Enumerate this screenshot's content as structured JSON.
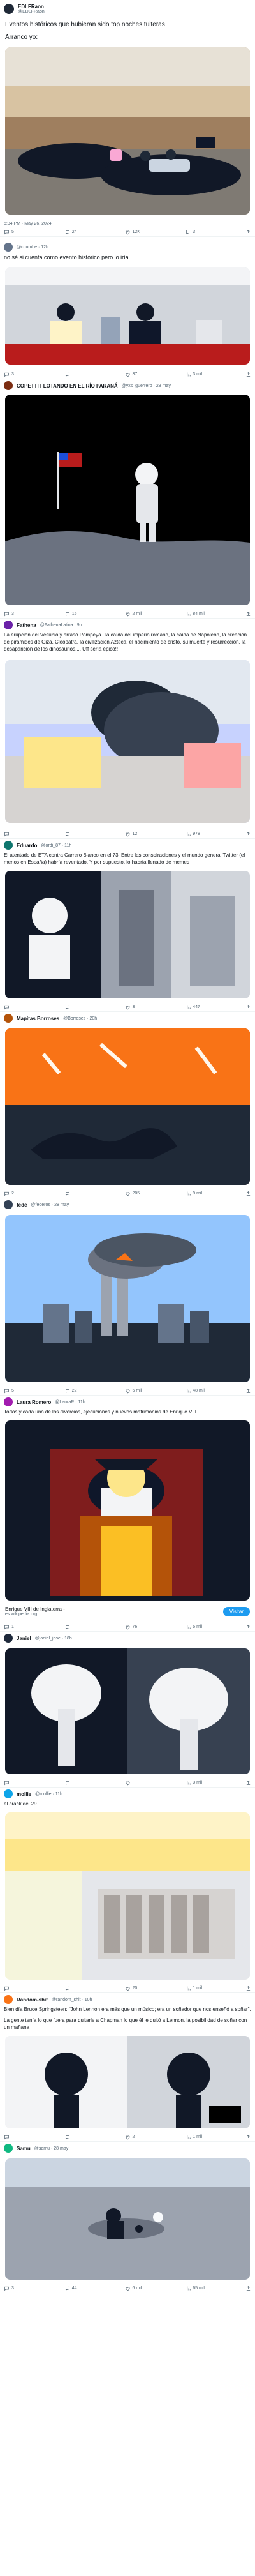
{
  "main_tweet": {
    "author_name": "EDLFRaon",
    "handle": "@EDLFRaon",
    "text_title": "Eventos históricos que hubieran sido top noches tuiteras",
    "text_intro": "Arranco yo:",
    "stats": "5:34 PM · May 26, 2024",
    "counts": {
      "replies": "5",
      "retweets": "24",
      "likes": "12K",
      "bookmarks": "3",
      "views": "1.3M"
    }
  },
  "replies": [
    {
      "handle": "@chumbe",
      "time": "12h",
      "text": "no sé si cuenta como evento histórico pero lo iría",
      "counts": {
        "replies": "3",
        "retweets": "",
        "likes": "37",
        "views": "3 mil"
      }
    },
    {
      "name": "COPETTI FLOTANDO EN EL RÍO PARANÁ",
      "handle": "@yxs_guerrero",
      "time": "28 may",
      "counts": {
        "replies": "3",
        "retweets": "15",
        "likes": "2 mil",
        "views": "84 mil"
      }
    },
    {
      "name": "Fathena",
      "handle": "@FathenaLatina",
      "time": "9h",
      "text": "La erupción del Vesubio y arrasó Pompeya...la caída del imperio romano, la caída de Napoleón, la creación de pirámides de Giza, Cleopatra, la civilización Azteca, el nacimiento de cristo, su muerte y resurrección, la desaparición de los dinosaurios.... Uff sería épico!!",
      "counts": {
        "replies": "",
        "retweets": "",
        "likes": "12",
        "views": "978"
      }
    },
    {
      "name": "Eduardo",
      "handle": "@ordi_87",
      "time": "11h",
      "text": "El atentado de ETA contra Carrero Blanco en el 73. Entre las conspiraciones y el mundo general Twitter (el menos en España) habría reventado. Y por supuesto, lo habría llenado de memes",
      "counts": {
        "replies": "",
        "retweets": "",
        "likes": "3",
        "views": "447"
      }
    },
    {
      "name": "Mapitas Borroses",
      "handle": "@Borroses",
      "time": "20h",
      "counts": {
        "replies": "2",
        "retweets": "",
        "likes": "205",
        "views": "9 mil"
      }
    },
    {
      "name": "fede",
      "handle": "@federos",
      "time": "28 may",
      "counts": {
        "replies": "5",
        "retweets": "22",
        "likes": "6 mil",
        "views": "48 mil"
      }
    },
    {
      "name": "Laura Romero",
      "handle": "@LauraR",
      "time": "11h",
      "text": "Todos y cada uno de los divorcios, ejecuciones y nuevos matrimonios de Enrique VIII.",
      "link_title": "Enrique VIII de Inglaterra -",
      "link_sub": "es.wikipedia.org",
      "link_button": "Visitar",
      "counts": {
        "replies": "1",
        "retweets": "",
        "likes": "76",
        "views": "5 mil"
      }
    },
    {
      "name": "Janiel",
      "handle": "@janiel_jose",
      "time": "18h",
      "counts": {
        "replies": "",
        "retweets": "",
        "likes": "",
        "views": "3 mil"
      }
    },
    {
      "name": "mollie",
      "handle": "@mollie",
      "time": "11h",
      "text": "el crack del 29",
      "counts": {
        "replies": "",
        "retweets": "",
        "likes": "20",
        "views": "1 mil"
      }
    },
    {
      "name": "Random-shit",
      "handle": "@random_shit",
      "time": "10h",
      "text": "Bien día Bruce Springsteen: \"John Lennon era más que un músico; era un soñador que nos enseñó a soñar\".",
      "text2": "La gente tenía lo que fuera para quitarle a Chapman lo que él le quitó a Lennon, la posibilidad de soñar con un mañana",
      "counts": {
        "replies": "",
        "retweets": "",
        "likes": "2",
        "views": "1 mil"
      }
    },
    {
      "name": "Samu",
      "handle": "@samu",
      "time": "28 may",
      "counts": {
        "replies": "3",
        "retweets": "44",
        "likes": "6 mil",
        "views": "65 mil"
      }
    }
  ],
  "colors": {
    "accent": "#1d9bf0",
    "muted": "#536471",
    "divider": "#eff3f4"
  }
}
